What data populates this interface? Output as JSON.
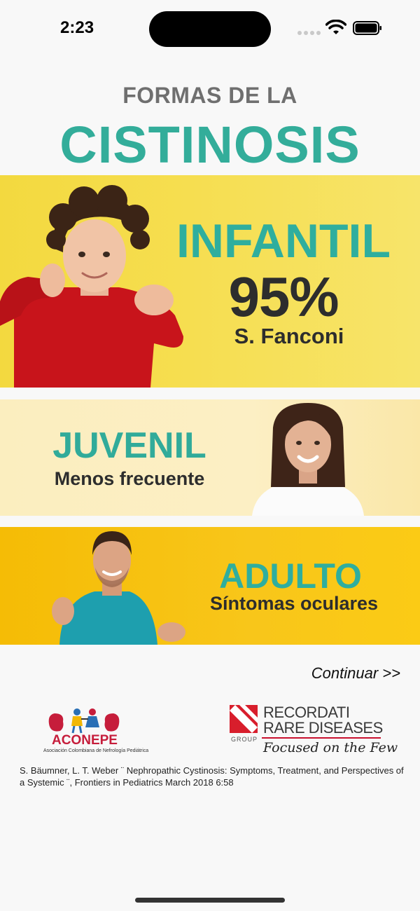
{
  "status_bar": {
    "time": "2:23"
  },
  "header": {
    "small_title": "FORMAS DE LA",
    "big_title": "CISTINOSIS"
  },
  "banners": {
    "infantil": {
      "heading": "INFANTIL",
      "percent": "95%",
      "subtitle": "S. Fanconi"
    },
    "juvenil": {
      "heading": "JUVENIL",
      "subtitle": "Menos frecuente"
    },
    "adulto": {
      "heading": "ADULTO",
      "subtitle": "Síntomas oculares"
    }
  },
  "navigation": {
    "continue_label": "Continuar >>"
  },
  "logos": {
    "aconepe_name": "ACONEPE",
    "aconepe_full": "Asociación Colombiana de Nefrología Pediátrica",
    "recordati_line1": "RECORDATI",
    "recordati_line2": "RARE DISEASES",
    "recordati_group": "GROUP",
    "recordati_tagline": "Focused on the Few"
  },
  "reference": {
    "text": "S. Bäumner, L. T. Weber ¨ Nephropathic Cystinosis: Symptoms, Treatment, and Perspectives of a Systemic ¨, Frontiers in Pediatrics March 2018  6:58"
  },
  "colors": {
    "teal": "#33ad9a",
    "gray_title": "#6f6f6f",
    "infantil_bg": "#f6de50",
    "juvenil_bg": "#fcefc4",
    "adulto_bg": "#f8c61a"
  }
}
